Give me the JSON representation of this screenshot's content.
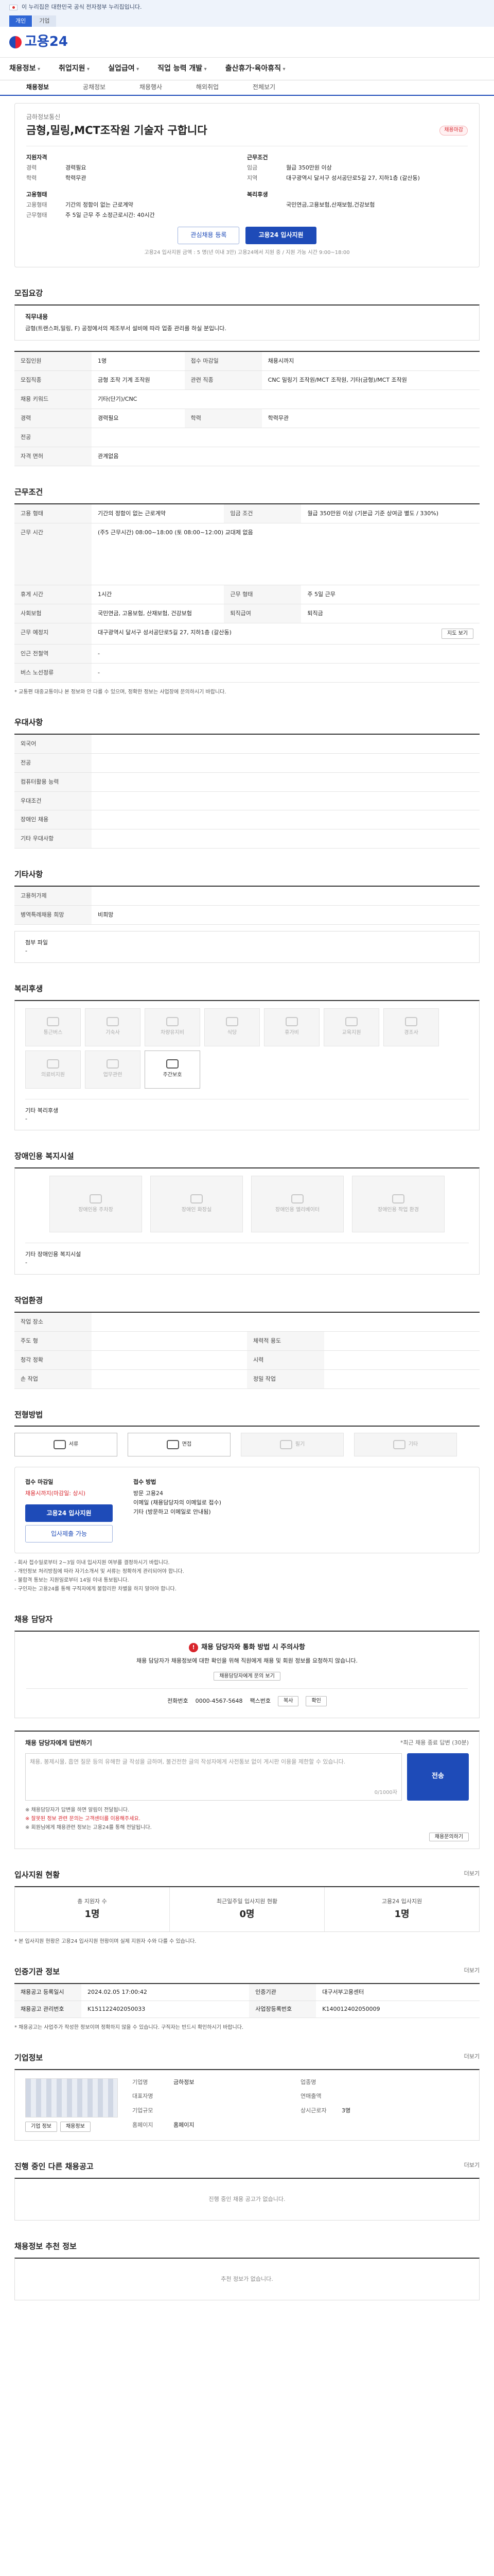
{
  "gov": {
    "text": "이 누리집은 대한민국 공식 전자정부 누리집입니다.",
    "tabs": [
      "개인",
      "기업"
    ]
  },
  "site": {
    "logo": "고용24"
  },
  "gnb": [
    "채용정보",
    "취업지원",
    "실업급여",
    "직업 능력 개발",
    "출산휴가·육아휴직"
  ],
  "subtabs": [
    "채용정보",
    "공채정보",
    "채용행사",
    "해외취업",
    "전체보기"
  ],
  "header": {
    "company": "금하정보통신",
    "title": "금형,밀링,MCT조작원 기술자 구합니다",
    "badge": "채용마감",
    "rows": [
      [
        [
          "지원자격",
          ""
        ],
        [
          "근무조건",
          ""
        ]
      ],
      [
        [
          "경력",
          "경력필요"
        ],
        [
          "임금",
          "월급 350만원 이상"
        ]
      ],
      [
        [
          "학력",
          "학력무관"
        ],
        [
          "지역",
          "대구광역시 달서구 성서공단로5길 27, 지하1층 (갈산동)"
        ]
      ],
      [
        [
          "고용형태",
          ""
        ],
        [
          "복리후생",
          ""
        ]
      ],
      [
        [
          "고용형태",
          "기간의 정함이 없는 근로계약"
        ],
        [
          "",
          "국민연금,고용보험,산재보험,건강보험"
        ]
      ],
      [
        [
          "근무형태",
          "주 5일 근무 주 소정근로시간: 40시간"
        ],
        [
          "",
          ""
        ]
      ]
    ],
    "btn_interest": "관심채용 등록",
    "btn_apply": "고용24 입사지원",
    "note": "고용24 입사지원 금액 : 5 명(년 이내 3만) 고용24에서 지원 중 / 지원 가능 시간 9:00~18:00"
  },
  "recruit": {
    "title": "모집요강",
    "job_title": "직무내용",
    "job_desc": "금형(트랜스퍼,밀링, F) 공정에서의 제조부서 설비에 따라 업종 관리를 하실 분입니다.",
    "rows": [
      [
        "모집인원",
        "1명",
        "접수 마감일",
        "채용시까지"
      ],
      [
        "모집직종",
        "금형 조작 기계 조작원",
        "관련 직종",
        "CNC 밀링기 조작원/MCT 조작원, 기타(금형)/MCT 조작원"
      ],
      [
        "채용 키워드",
        "기타(단기)/CNC",
        "",
        ""
      ],
      [
        "경력",
        "경력필요",
        "학력",
        "학력무관"
      ],
      [
        "전공",
        "",
        "",
        " "
      ],
      [
        "자격 면허",
        "관계없음",
        "",
        ""
      ]
    ]
  },
  "work": {
    "title": "근무조건",
    "rows": [
      [
        "고용 형태",
        "기간의 정함이 없는 근로계약",
        "임금 조건",
        "월급 350만원 이상 (기본급 기준 상여금 별도 / 330%)"
      ],
      [
        "근무 예정지",
        "",
        "",
        ""
      ],
      [
        "근무 시간",
        "(주5 근무시간) 08:00~18:00 (토 08:00~12:00) 교대제 없음",
        "",
        ""
      ],
      [
        "휴게 시간",
        "1시간",
        "근무 형태",
        "주 5일 근무"
      ],
      [
        "사회보험",
        "국민연금, 고용보험, 산재보험, 건강보험",
        "퇴직급여",
        "퇴직금"
      ],
      [
        "근무 예정지",
        "대구광역시 달서구 성서공단로5길 27, 지하1층 (갈산동)",
        "",
        ""
      ],
      [
        "인근 전철역",
        "-",
        "",
        ""
      ],
      [
        "버스 노선정류",
        "-",
        "",
        ""
      ]
    ],
    "map_btn": "지도 보기",
    "footnote": "* 교통편 대중교통이나 본 정보와 안 다를 수 있으며, 정확한 정보는 사업장에 문의하시기 바랍니다."
  },
  "welfare": {
    "title": "우대사항",
    "rows": [
      [
        "외국어",
        ""
      ],
      [
        "전공",
        ""
      ],
      [
        "컴퓨터활용 능력",
        ""
      ],
      [
        "우대조건",
        ""
      ],
      [
        "장애인 채용",
        ""
      ],
      [
        "기타 우대사항",
        ""
      ]
    ]
  },
  "other": {
    "title": "기타사항",
    "rows": [
      [
        "고용허가제",
        ""
      ],
      [
        "병역특례채용 희망",
        "비희망"
      ]
    ],
    "attach": "첨부 파일",
    "attach_val": "-"
  },
  "benefit": {
    "title": "복리후생",
    "tiles": [
      "통근버스",
      "기숙사",
      "차량유지비",
      "식당",
      "휴가비",
      "교육지원",
      "경조사",
      "의료비지원",
      "업무관련"
    ],
    "on_tile": "주간보호",
    "etc_label": "기타 복리후생",
    "etc_val": "-"
  },
  "disabled": {
    "title": "장애인용 복지시설",
    "tiles": [
      "장애인용 주차장",
      "장애인 화장실",
      "장애인용 엘리베이터",
      "장애인용 작업 환경"
    ],
    "etc_label": "기타 장애인용 복지시설",
    "etc_val": "-"
  },
  "workenv": {
    "title": "작업환경",
    "rows": [
      [
        "작업 장소",
        "",
        "",
        ""
      ],
      [
        "주도 형",
        "",
        "체력적 용도",
        ""
      ],
      [
        "청각 정확",
        "",
        " 시력",
        ""
      ],
      [
        "손 작업",
        "",
        "정밀 작업",
        ""
      ]
    ]
  },
  "apply": {
    "title": "전형방법",
    "tabs": [
      "서류",
      "면접",
      "필기",
      "기타"
    ],
    "recv_title": "접수 마감일",
    "recv_val": "채용시까지(마감일: 상시)",
    "method_title": "접수 방법",
    "methods": [
      "방문 고용24",
      "이메일 (채용담당자의 이메일로 접수)",
      "기타 (방문하고 이메일로 안내됨)"
    ],
    "btn_apply": "고용24 입사지원",
    "btn_online": "입사제출 가능",
    "bullets": [
      "- 회사 접수일로부터 2~3일 이내 입사지원 여부를 결정하시기 바랍니다.",
      "- 개인정보 처리방침에 따라 자기소개서 및 서류는 정확하게 관리되어야 합니다.",
      "- 불합격 통보는 지원일로부터 14일 이내 통보됩니다.",
      "- 구인자는 고용24를 통해 구직자에게 불합리한 차별을 하지 말아야 합니다."
    ]
  },
  "contact": {
    "title": "채용 담당자",
    "alert": "채용 담당자와 통화 방법 시 주의사항",
    "desc": "채용 담당자가 채용정보에 대한 확인을 위해 직원에게 채용 및 회원 정보를 요청하지 않습니다.",
    "kakao": "채용담당자에게 문의 보기",
    "phone_label": "전화번호",
    "phone": "0000-4567-5648",
    "fax_label": "팩스번호",
    "btn1": "복사",
    "btn2": "확인"
  },
  "chat": {
    "title": "채용 담당자에게 답변하기",
    "hint": "*최근 채용 종료 답변 (30분)",
    "placeholder": "채용, 봉제시물, 흡연 질문 등의 유해한 글 작성을 금하며, 불건전한 글의 작성자에게 사전통보 없이 게시판 이용을 제한할 수 있습니다.",
    "count": "0/1000자",
    "send": "전송",
    "bullets": [
      "※ 채용담당자가 답변을 하면 알림이 전달됩니다.",
      "※ 잘못된 정보 관련 문의는 고객센터를 이용해주세요.",
      "※ 회원님에게 채용관련 정보는 고용24를 통해 전달됩니다."
    ],
    "btn": "채용문의하기"
  },
  "stats": {
    "title": "입사지원 현황",
    "more": "더보기",
    "items": [
      [
        "총 지원자 수",
        "1명"
      ],
      [
        "최근일주일 입사지원 현황",
        "0명"
      ],
      [
        "고용24 입사지원",
        "1명"
      ]
    ],
    "note": "* 본 입사지원 현황은 고용24 입사지원 현황이며 실제 지원자 수와 다를 수 있습니다."
  },
  "agency": {
    "title": "인증기관 정보",
    "rows": [
      [
        "채용공고 등록일시",
        "2024.02.05 17:00:42",
        "인증기관",
        "대구서부고용센터"
      ],
      [
        "채용공고 관리번호",
        "K151122402050033",
        "사업장등록번호",
        "K140012402050009"
      ]
    ],
    "btn": "더보기",
    "note": "* 채용공고는 사업주가 작성한 정보이며 정확하지 않을 수 있습니다. 구직자는 반드시 확인하시기 바랍니다."
  },
  "company": {
    "title": "기업정보",
    "more": "더보기",
    "rows": [
      [
        "기업명",
        "금하정보",
        "업종명",
        ""
      ],
      [
        "대표자명",
        "",
        "연매출액",
        ""
      ],
      [
        "기업규모",
        "",
        "상시근로자",
        "3명"
      ],
      [
        "홈페이지",
        "홈페이지",
        "",
        ""
      ]
    ],
    "btn_a": "기업 정보",
    "btn_b": "채용정보"
  },
  "next": {
    "title": "진행 중인 다른 채용공고",
    "more": "더보기",
    "empty": "진행 중인 채용 공고가 없습니다."
  },
  "recommend": {
    "title": "채용정보 추천 정보",
    "empty": "추천 정보가 없습니다."
  }
}
